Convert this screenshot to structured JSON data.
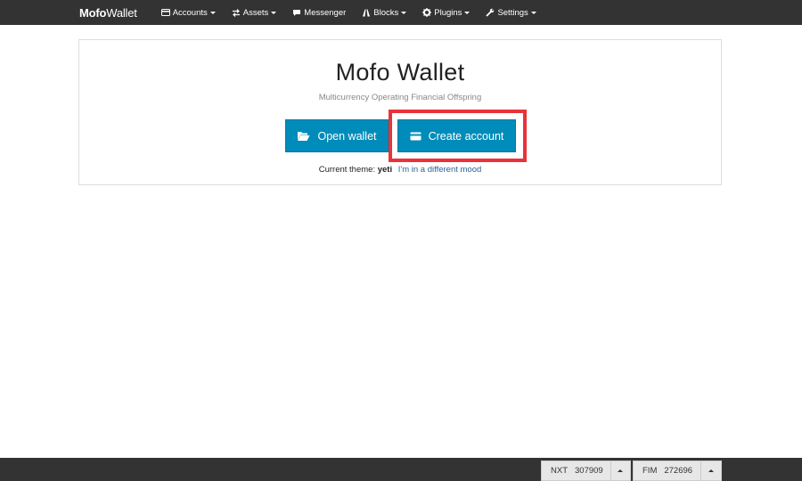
{
  "navbar": {
    "brand_bold": "Mofo",
    "brand_light": "Wallet",
    "items": [
      {
        "label": "Accounts",
        "icon": "credit-card-icon",
        "dropdown": true
      },
      {
        "label": "Assets",
        "icon": "transfer-icon",
        "dropdown": true
      },
      {
        "label": "Messenger",
        "icon": "comment-icon",
        "dropdown": false
      },
      {
        "label": "Blocks",
        "icon": "road-icon",
        "dropdown": true
      },
      {
        "label": "Plugins",
        "icon": "cog-icon",
        "dropdown": true
      },
      {
        "label": "Settings",
        "icon": "wrench-icon",
        "dropdown": true
      }
    ]
  },
  "main": {
    "title": "Mofo Wallet",
    "subtitle": "Multicurrency Operating Financial Offspring",
    "open_wallet_label": "Open wallet",
    "create_account_label": "Create account",
    "theme_prefix": "Current theme:",
    "theme_name": "yeti",
    "theme_link": "I'm in a different mood"
  },
  "footer": {
    "coins": [
      {
        "name": "NXT",
        "block": "307909"
      },
      {
        "name": "FIM",
        "block": "272696"
      }
    ]
  },
  "colors": {
    "navbar_bg": "#333333",
    "button_bg": "#008cba",
    "highlight": "#e8333b",
    "link": "#2a6496"
  }
}
